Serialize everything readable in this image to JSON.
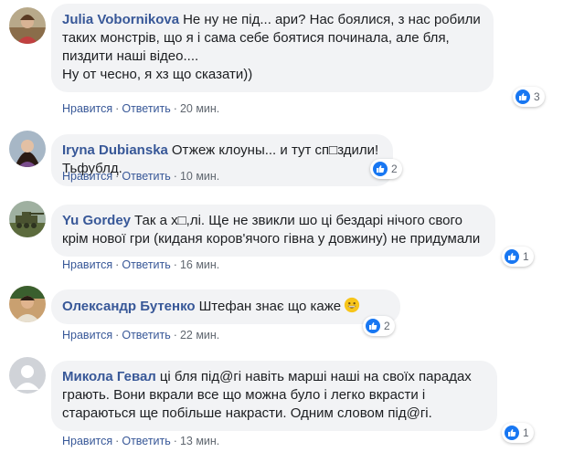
{
  "action_labels": {
    "like": "Нравится",
    "reply": "Ответить",
    "separator": "·"
  },
  "colors": {
    "author": "#385898",
    "bubble": "#f2f3f5",
    "like_blue": "#1877f2",
    "meta": "#606770"
  },
  "comments": [
    {
      "author": "Julia Vobornikova",
      "text": "Не ну не під... ари? Нас боялися, з нас робили таких монстрів, що я і сама себе боятися починала, але бля, пиздити наші відео....\nНу от чесно, я хз що сказати))",
      "time": "20 мин.",
      "reactions": "3",
      "reaction_icon": "like-icon"
    },
    {
      "author": "Iryna Dubianska",
      "text": "Отжеж клоуны... и тут сп□здили! Тьфублд.",
      "time": "10 мин.",
      "reactions": "2",
      "reaction_icon": "like-icon"
    },
    {
      "author": "Yu Gordey",
      "text": "Так а х□,лі. Ще не звикли шо ці бездарі нічого свого крім нової гри (киданя коров'ячого гівна у довжину) не придумали",
      "time": "16 мин.",
      "reactions": "1",
      "reaction_icon": "like-icon"
    },
    {
      "author": "Олександр Бутенко",
      "text": "Штефан знає що каже",
      "emoji": "grinning-face-emoji",
      "time": "22 мин.",
      "reactions": "2",
      "reaction_icon": "like-icon"
    },
    {
      "author": "Микола Гевал",
      "text": "ці бля під@гі навіть марші наші на своїх парадах грають. Вони вкрали все що можна було і легко вкрасти і стараються ще побільше накрасти. Одним словом під@гі.",
      "time": "13 мин.",
      "reactions": "1",
      "reaction_icon": "like-icon"
    }
  ]
}
